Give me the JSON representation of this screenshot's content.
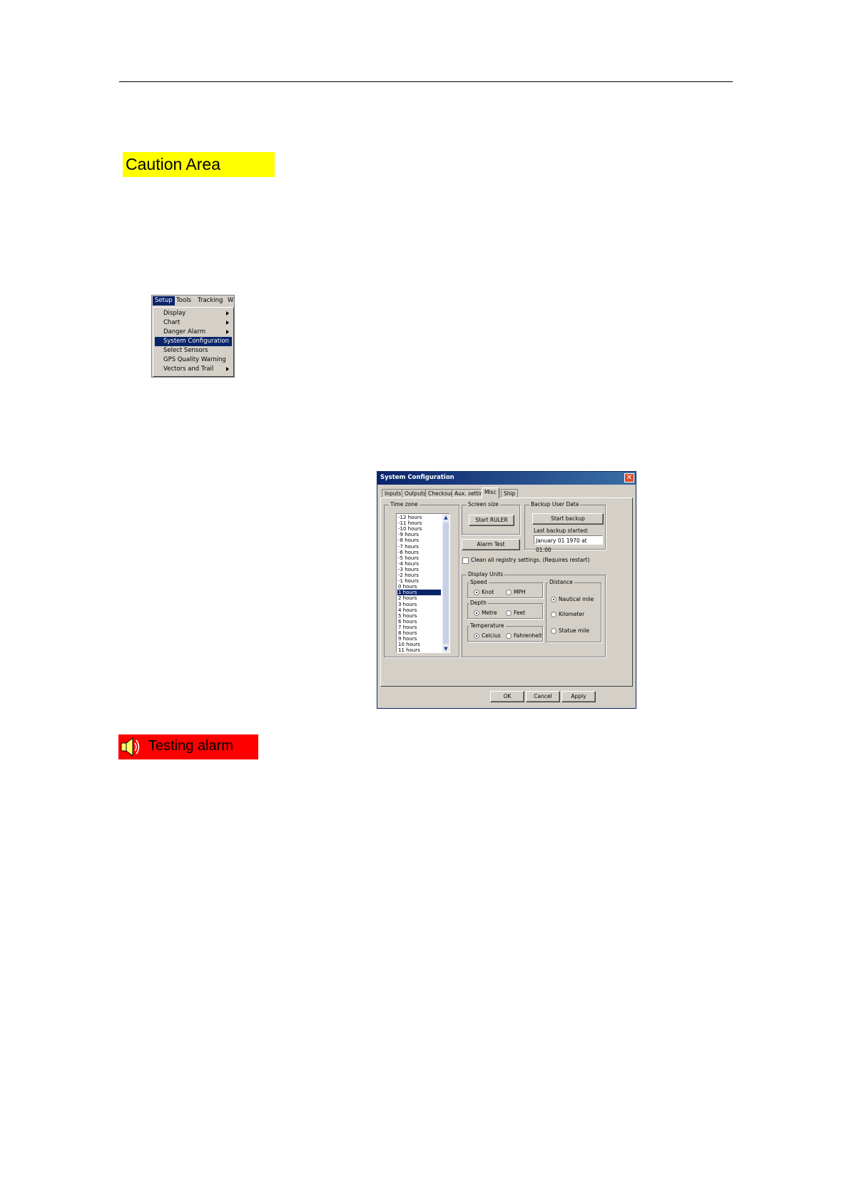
{
  "caution_label": "Caution Area",
  "menu": {
    "bar": [
      "Setup",
      "Tools",
      "Tracking",
      "W"
    ],
    "items": [
      "Display",
      "Chart",
      "Danger Alarm",
      "System Configuration",
      "Select Sensors",
      "GPS Quality Warning",
      "Vectors and Trail"
    ],
    "highlighted": "System Configuration"
  },
  "dialog": {
    "title": "System Configuration",
    "close_glyph": "✕",
    "tabs": [
      "Inputs",
      "Outputs",
      "Checksum",
      "Aux. setting",
      "Misc",
      "Ship"
    ],
    "active_tab": "Misc",
    "time_zone": {
      "label": "Time zone",
      "items": [
        "-12 hours",
        "-11 hours",
        "-10 hours",
        "-9 hours",
        "-8 hours",
        "-7 hours",
        "-6 hours",
        "-5 hours",
        "-4 hours",
        "-3 hours",
        "-2 hours",
        "-1 hours",
        "0 hours",
        "1 hours",
        "2 hours",
        "3 hours",
        "4 hours",
        "5 hours",
        "6 hours",
        "7 hours",
        "8 hours",
        "9 hours",
        "10 hours",
        "11 hours"
      ],
      "selected": "1 hours"
    },
    "screen_size": {
      "label": "Screen size",
      "button": "Start RULER"
    },
    "alarm_test_button": "Alarm Test",
    "backup": {
      "label": "Backup User Data",
      "button": "Start backup",
      "last_label": "Last backup started:",
      "last_value": "January 01 1970 at 01:00"
    },
    "clean_registry": "Clean all registry settings. (Requires restart)",
    "display_units": {
      "label": "Display Units",
      "speed": {
        "label": "Speed",
        "options": [
          "Knot",
          "MPH"
        ],
        "selected": "Knot"
      },
      "depth": {
        "label": "Depth",
        "options": [
          "Metre",
          "Feet"
        ],
        "selected": "Metre"
      },
      "temperature": {
        "label": "Temperature",
        "options": [
          "Celcius",
          "Fahrenheit"
        ],
        "selected": "Celcius"
      },
      "distance": {
        "label": "Distance",
        "options": [
          "Nautical mile",
          "Kilometer",
          "Statue mile"
        ],
        "selected": "Nautical mile"
      }
    },
    "buttons": {
      "ok": "OK",
      "cancel": "Cancel",
      "apply": "Apply"
    }
  },
  "testing_label": "Testing alarm",
  "colors": {
    "caution_bg": "#ffff00",
    "testing_bg": "#ff0000",
    "title_bar": "#0a246a"
  }
}
